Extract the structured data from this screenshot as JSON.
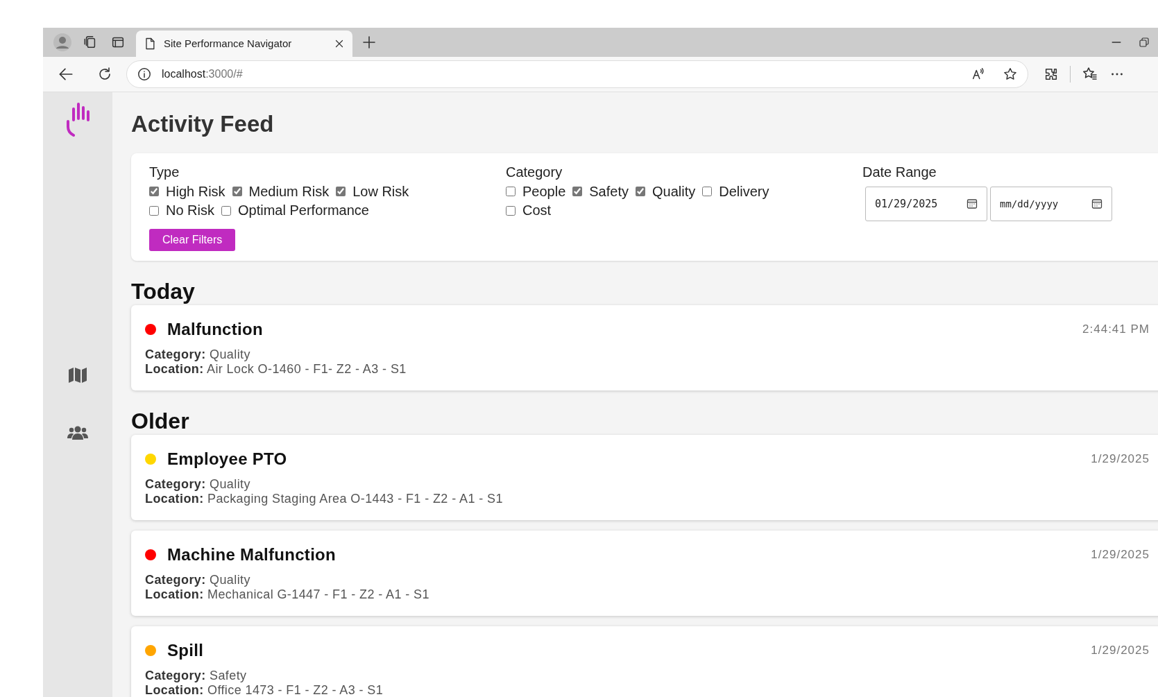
{
  "browser": {
    "tab_title": "Site Performance Navigator",
    "url_host": "localhost",
    "url_rest": ":3000/#"
  },
  "page_title": "Activity Feed",
  "filters": {
    "groups": [
      {
        "label": "Type",
        "options": [
          {
            "label": "High Risk",
            "checked": true
          },
          {
            "label": "Medium Risk",
            "checked": true
          },
          {
            "label": "Low Risk",
            "checked": true
          },
          {
            "label": "No Risk",
            "checked": false
          },
          {
            "label": "Optimal Performance",
            "checked": false
          }
        ]
      },
      {
        "label": "Category",
        "options": [
          {
            "label": "People",
            "checked": false
          },
          {
            "label": "Safety",
            "checked": true
          },
          {
            "label": "Quality",
            "checked": true
          },
          {
            "label": "Delivery",
            "checked": false
          },
          {
            "label": "Cost",
            "checked": false
          }
        ]
      }
    ],
    "clear_button": "Clear Filters",
    "date_range": {
      "label": "Date Range",
      "start": {
        "value": "01/29/2025"
      },
      "end": {
        "placeholder": "mm/dd/yyyy"
      }
    }
  },
  "sections": [
    {
      "heading": "Today",
      "events": [
        {
          "title": "Malfunction",
          "color": "#ff0000",
          "time": "2:44:41 PM",
          "category": "**Category:** Quality",
          "location": "**Location:** Air Lock O-1460 - F1- Z2 - A3 - S1"
        }
      ]
    },
    {
      "heading": "Older",
      "events": [
        {
          "title": "Employee PTO",
          "color": "#ffd700",
          "time": "1/29/2025",
          "category": "**Category:** Quality",
          "location": "**Location:** Packaging Staging Area O-1443 - F1 - Z2 - A1 - S1"
        },
        {
          "title": "Machine Malfunction",
          "color": "#ff0000",
          "time": "1/29/2025",
          "category": "**Category:** Quality",
          "location": "**Location:** Mechanical G-1447 - F1 - Z2 - A1 - S1"
        },
        {
          "title": "Spill",
          "color": "#ffa500",
          "time": "1/29/2025",
          "category": "**Category:** Safety",
          "location": "**Location:** Office 1473 - F1 - Z2 - A3 - S1"
        }
      ]
    }
  ]
}
